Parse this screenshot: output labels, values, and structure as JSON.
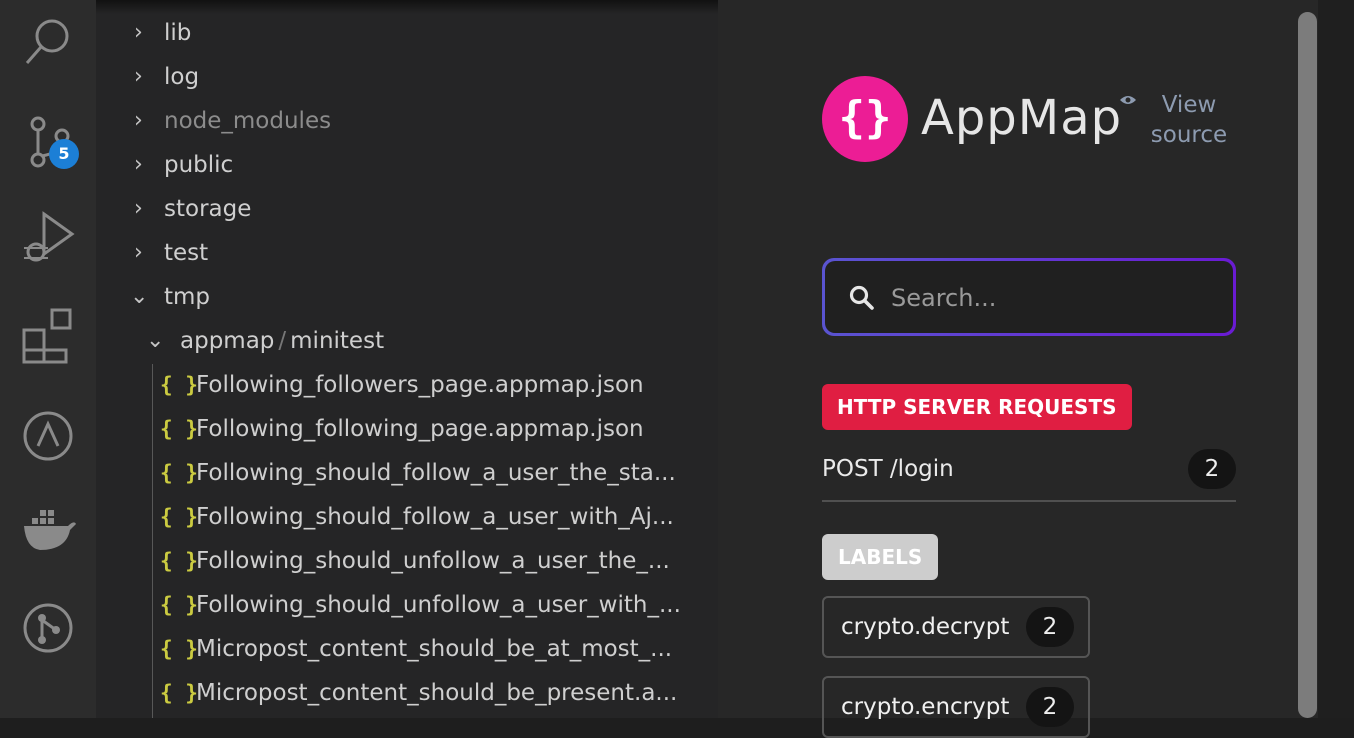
{
  "colors": {
    "activity_bar_bg": "#2c2c2c",
    "explorer_bg": "#252526",
    "panel_bg": "#272727",
    "badge_blue": "#1c7fd6",
    "json_icon_yellow": "#cbcb41",
    "appmap_pink": "#ec1d95",
    "http_badge_red": "#e01e42",
    "labels_badge_gray": "#cdcdcd"
  },
  "activity_bar": {
    "items": [
      {
        "name": "search-icon"
      },
      {
        "name": "source-control-icon",
        "badge": "5"
      },
      {
        "name": "run-debug-icon"
      },
      {
        "name": "extensions-icon"
      },
      {
        "name": "appmap-icon"
      },
      {
        "name": "docker-icon"
      },
      {
        "name": "git-graph-icon"
      }
    ]
  },
  "explorer": {
    "folders": [
      {
        "label": "lib",
        "expanded": false
      },
      {
        "label": "log",
        "expanded": false
      },
      {
        "label": "node_modules",
        "expanded": false,
        "dimmed": true
      },
      {
        "label": "public",
        "expanded": false
      },
      {
        "label": "storage",
        "expanded": false
      },
      {
        "label": "test",
        "expanded": false
      },
      {
        "label": "tmp",
        "expanded": true
      }
    ],
    "subfolder": {
      "part1": "appmap",
      "part2": "minitest",
      "separator": "/"
    },
    "files": [
      {
        "icon": "{ }",
        "label": "Following_followers_page.appmap.json"
      },
      {
        "icon": "{ }",
        "label": "Following_following_page.appmap.json"
      },
      {
        "icon": "{ }",
        "label": "Following_should_follow_a_user_the_sta..."
      },
      {
        "icon": "{ }",
        "label": "Following_should_follow_a_user_with_Aj..."
      },
      {
        "icon": "{ }",
        "label": "Following_should_unfollow_a_user_the_..."
      },
      {
        "icon": "{ }",
        "label": "Following_should_unfollow_a_user_with_..."
      },
      {
        "icon": "{ }",
        "label": "Micropost_content_should_be_at_most_..."
      },
      {
        "icon": "{ }",
        "label": "Micropost_content_should_be_present.a..."
      }
    ]
  },
  "appmap": {
    "logo_glyph": "{}",
    "logo_text": "AppMap",
    "view_source_line1": "View",
    "view_source_line2": "source",
    "search_placeholder": "Search...",
    "http_section_title": "HTTP SERVER REQUESTS",
    "requests": [
      {
        "label": "POST /login",
        "count": "2"
      }
    ],
    "labels_section_title": "LABELS",
    "labels": [
      {
        "label": "crypto.decrypt",
        "count": "2"
      },
      {
        "label": "crypto.encrypt",
        "count": "2"
      }
    ]
  }
}
